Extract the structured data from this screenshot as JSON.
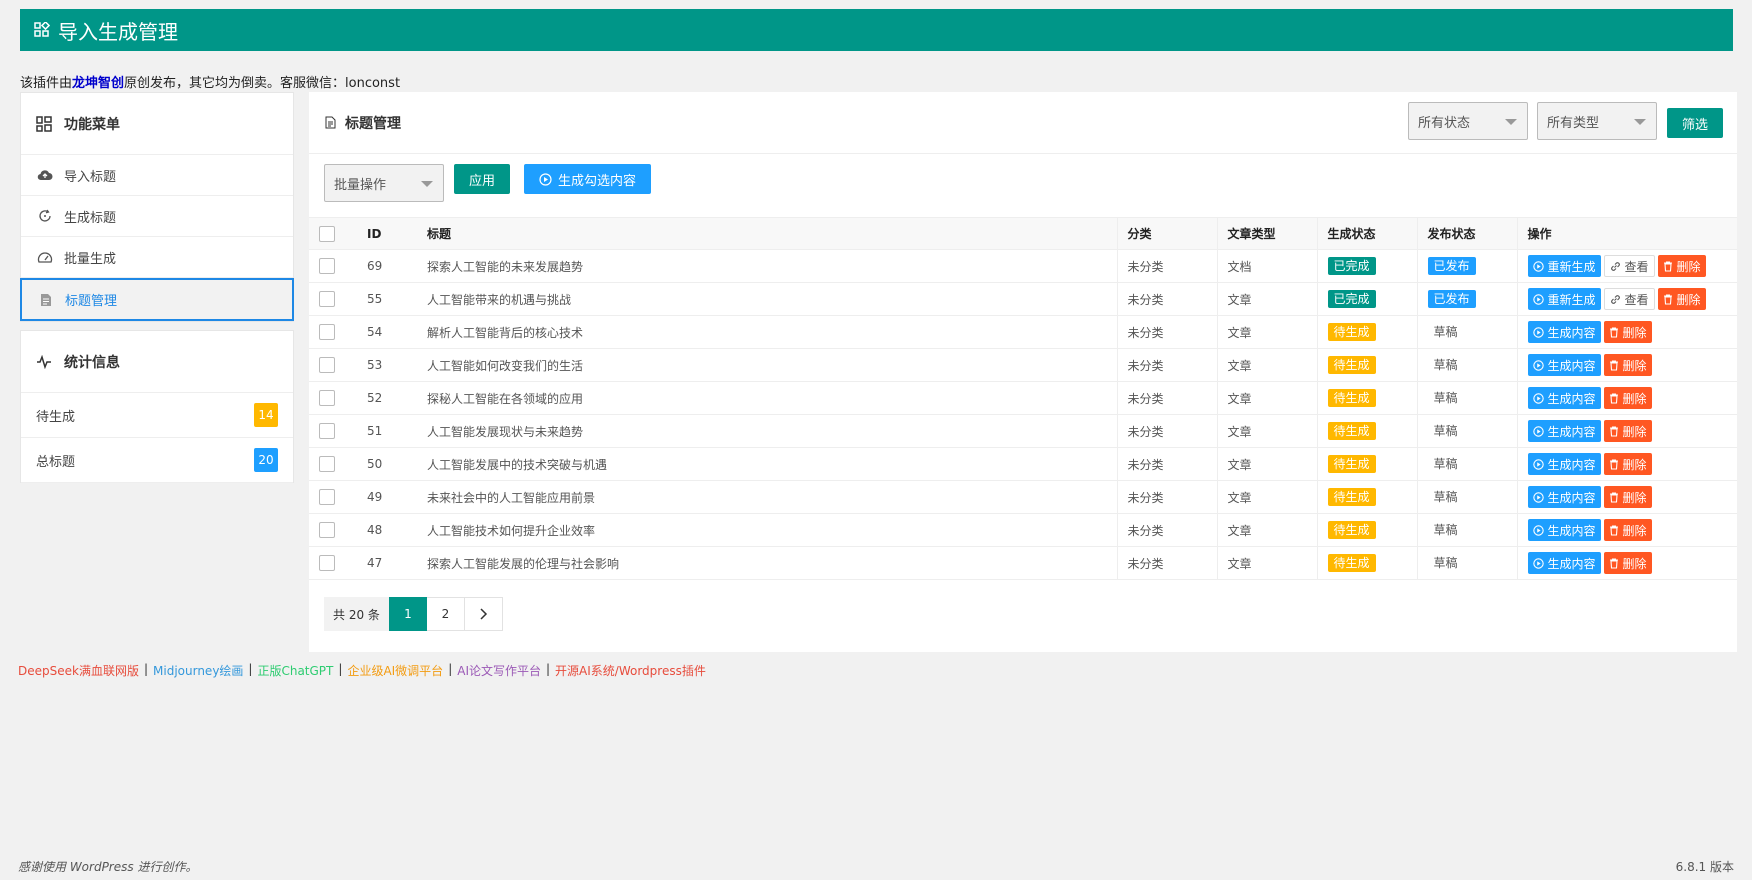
{
  "header": {
    "title": "导入生成管理"
  },
  "notice": {
    "prefix": "该插件由",
    "brand": "龙坤智创",
    "suffix": "原创发布，其它均为倒卖。客服微信：lonconst"
  },
  "menu": {
    "title": "功能菜单",
    "items": [
      {
        "label": "导入标题",
        "icon": "cloud-upload-icon"
      },
      {
        "label": "生成标题",
        "icon": "refresh-icon"
      },
      {
        "label": "批量生成",
        "icon": "dashboard-icon"
      },
      {
        "label": "标题管理",
        "icon": "file-icon",
        "active": true
      }
    ]
  },
  "stats": {
    "title": "统计信息",
    "rows": [
      {
        "label": "待生成",
        "count": "14",
        "color": "#ffb800"
      },
      {
        "label": "总标题",
        "count": "20",
        "color": "#1e9fff"
      }
    ]
  },
  "main": {
    "title": "标题管理",
    "status_filter": "所有状态",
    "type_filter": "所有类型",
    "filter_button": "筛选",
    "bulk_select": "批量操作",
    "apply_button": "应用",
    "generate_selected_button": "生成勾选内容"
  },
  "table": {
    "headers": [
      "ID",
      "标题",
      "分类",
      "文章类型",
      "生成状态",
      "发布状态",
      "操作"
    ],
    "rows": [
      {
        "id": "69",
        "title": "探索人工智能的未来发展趋势",
        "category": "未分类",
        "type": "文档",
        "gen": "已完成",
        "pub": "已发布"
      },
      {
        "id": "55",
        "title": "人工智能带来的机遇与挑战",
        "category": "未分类",
        "type": "文章",
        "gen": "已完成",
        "pub": "已发布"
      },
      {
        "id": "54",
        "title": "解析人工智能背后的核心技术",
        "category": "未分类",
        "type": "文章",
        "gen": "待生成",
        "pub": "草稿"
      },
      {
        "id": "53",
        "title": "人工智能如何改变我们的生活",
        "category": "未分类",
        "type": "文章",
        "gen": "待生成",
        "pub": "草稿"
      },
      {
        "id": "52",
        "title": "探秘人工智能在各领域的应用",
        "category": "未分类",
        "type": "文章",
        "gen": "待生成",
        "pub": "草稿"
      },
      {
        "id": "51",
        "title": "人工智能发展现状与未来趋势",
        "category": "未分类",
        "type": "文章",
        "gen": "待生成",
        "pub": "草稿"
      },
      {
        "id": "50",
        "title": "人工智能发展中的技术突破与机遇",
        "category": "未分类",
        "type": "文章",
        "gen": "待生成",
        "pub": "草稿"
      },
      {
        "id": "49",
        "title": "未来社会中的人工智能应用前景",
        "category": "未分类",
        "type": "文章",
        "gen": "待生成",
        "pub": "草稿"
      },
      {
        "id": "48",
        "title": "人工智能技术如何提升企业效率",
        "category": "未分类",
        "type": "文章",
        "gen": "待生成",
        "pub": "草稿"
      },
      {
        "id": "47",
        "title": "探索人工智能发展的伦理与社会影响",
        "category": "未分类",
        "type": "文章",
        "gen": "待生成",
        "pub": "草稿"
      }
    ],
    "actions": {
      "regenerate": "重新生成",
      "view": "查看",
      "delete": "删除",
      "generate": "生成内容"
    }
  },
  "pager": {
    "total": "共 20 条",
    "pages": [
      "1",
      "2"
    ],
    "current": "1"
  },
  "links": [
    {
      "label": "DeepSeek满血联网版",
      "color": "#e74c3c"
    },
    {
      "label": "Midjourney绘画",
      "color": "#3498db"
    },
    {
      "label": "正版ChatGPT",
      "color": "#2ecc71"
    },
    {
      "label": "企业级AI微调平台",
      "color": "#f39c12"
    },
    {
      "label": "AI论文写作平台",
      "color": "#9b59b6"
    },
    {
      "label": "开源AI系统/Wordpress插件",
      "color": "#e74c3c"
    }
  ],
  "footer": {
    "credit": "感谢使用 WordPress 进行创作。",
    "version": "6.8.1 版本"
  }
}
